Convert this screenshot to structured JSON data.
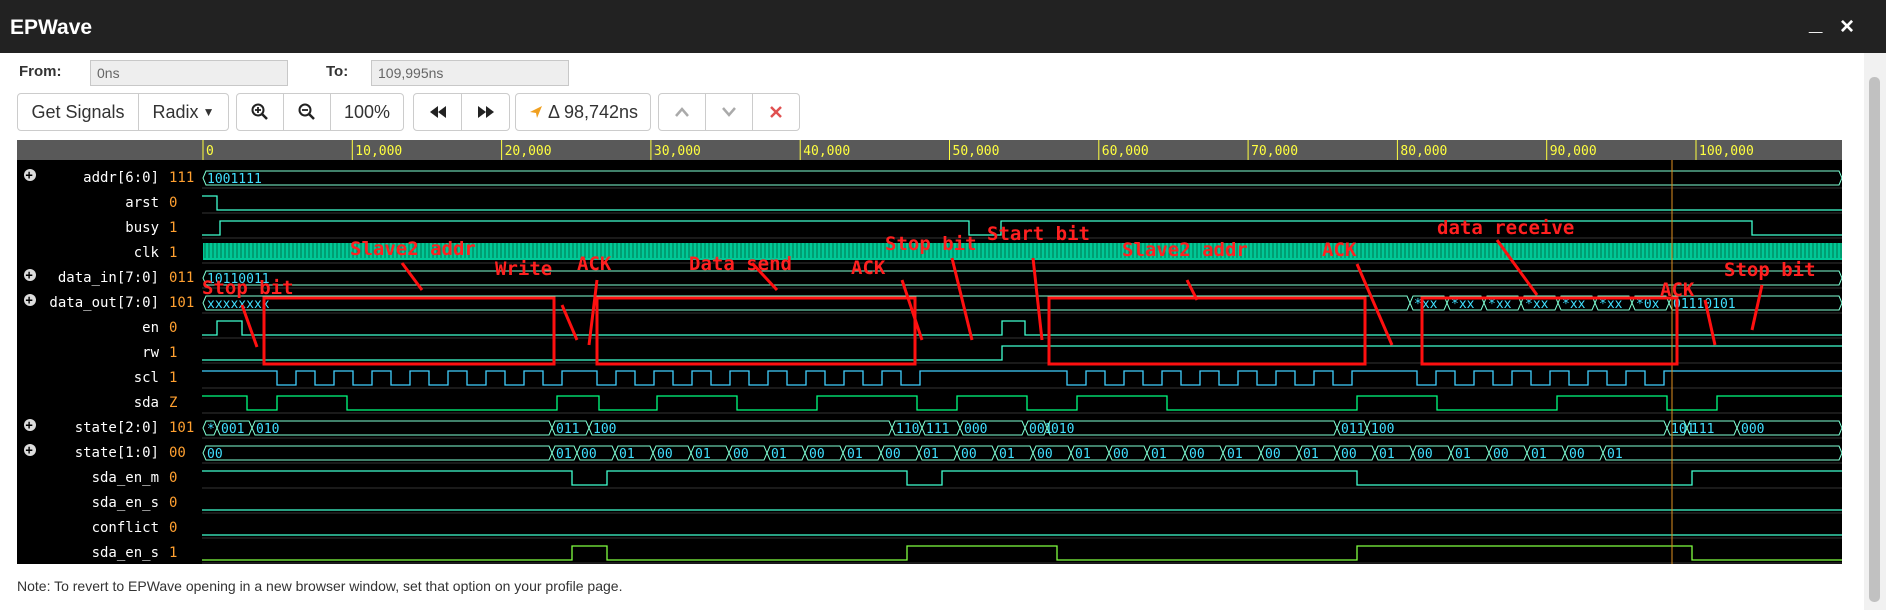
{
  "window": {
    "title": "EPWave",
    "minimize": "_",
    "close": "×"
  },
  "range": {
    "from_label": "From:",
    "from_value": "0ns",
    "to_label": "To:",
    "to_value": "109,995ns"
  },
  "toolbar": {
    "get_signals": "Get Signals",
    "radix": "Radix",
    "zoom": "100%",
    "delta": "Δ 98,742ns",
    "icons": [
      "zoom-in",
      "zoom-out",
      "rewind",
      "fast-forward",
      "cursor-arrow",
      "chevron-up",
      "chevron-down",
      "close"
    ]
  },
  "ruler": {
    "ticks": [
      "0",
      "10,000",
      "20,000",
      "30,000",
      "40,000",
      "50,000",
      "60,000",
      "70,000",
      "80,000",
      "90,000",
      "100,000"
    ]
  },
  "signals": [
    {
      "name": "addr[6:0]",
      "value": "111",
      "expandable": true
    },
    {
      "name": "arst",
      "value": "0",
      "expandable": false
    },
    {
      "name": "busy",
      "value": "1",
      "expandable": false
    },
    {
      "name": "clk",
      "value": "1",
      "expandable": false
    },
    {
      "name": "data_in[7:0]",
      "value": "011",
      "expandable": true
    },
    {
      "name": "data_out[7:0]",
      "value": "101",
      "expandable": true
    },
    {
      "name": "en",
      "value": "0",
      "expandable": false
    },
    {
      "name": "rw",
      "value": "1",
      "expandable": false
    },
    {
      "name": "scl",
      "value": "1",
      "expandable": false
    },
    {
      "name": "sda",
      "value": "Z",
      "expandable": false
    },
    {
      "name": "state[2:0]",
      "value": "101",
      "expandable": true
    },
    {
      "name": "state[1:0]",
      "value": "00",
      "expandable": true
    },
    {
      "name": "sda_en_m",
      "value": "0",
      "expandable": false
    },
    {
      "name": "sda_en_s",
      "value": "0",
      "expandable": false
    },
    {
      "name": "conflict",
      "value": "0",
      "expandable": false
    },
    {
      "name": "sda_en_s",
      "value": "1",
      "expandable": false
    }
  ],
  "wave_text": {
    "addr": "1001111",
    "data_in": "10110011",
    "data_out_start": "xxxxxxxx",
    "data_out_mid": [
      "*xx",
      "*xx",
      "*xx",
      "*xx",
      "*xx",
      "*xx",
      "*0x"
    ],
    "data_out_end": "01110101",
    "state3": [
      "*",
      "001",
      "010",
      "011",
      "100",
      "110",
      "111",
      "000",
      "001",
      "010",
      "011",
      "100",
      "101",
      "111",
      "000"
    ],
    "state2": [
      "00",
      "01",
      "00",
      "01",
      "00",
      "01",
      "00",
      "01",
      "00",
      "01",
      "00",
      "01",
      "00",
      "01",
      "00",
      "01",
      "00",
      "01",
      "00",
      "01",
      "00",
      "01",
      "00",
      "01",
      "00",
      "01",
      "00",
      "01",
      "00",
      "01"
    ]
  },
  "annotations": [
    "Stop bit",
    "Slave2 addr",
    "Write",
    "ACK",
    "Data send",
    "ACK",
    "Stop bit",
    "Start bit",
    "Slave2 addr",
    "ACK",
    "data receive",
    "ACK",
    "Stop bit"
  ],
  "note": "Note: To revert to EPWave opening in a new browser window, set that option on your profile page."
}
